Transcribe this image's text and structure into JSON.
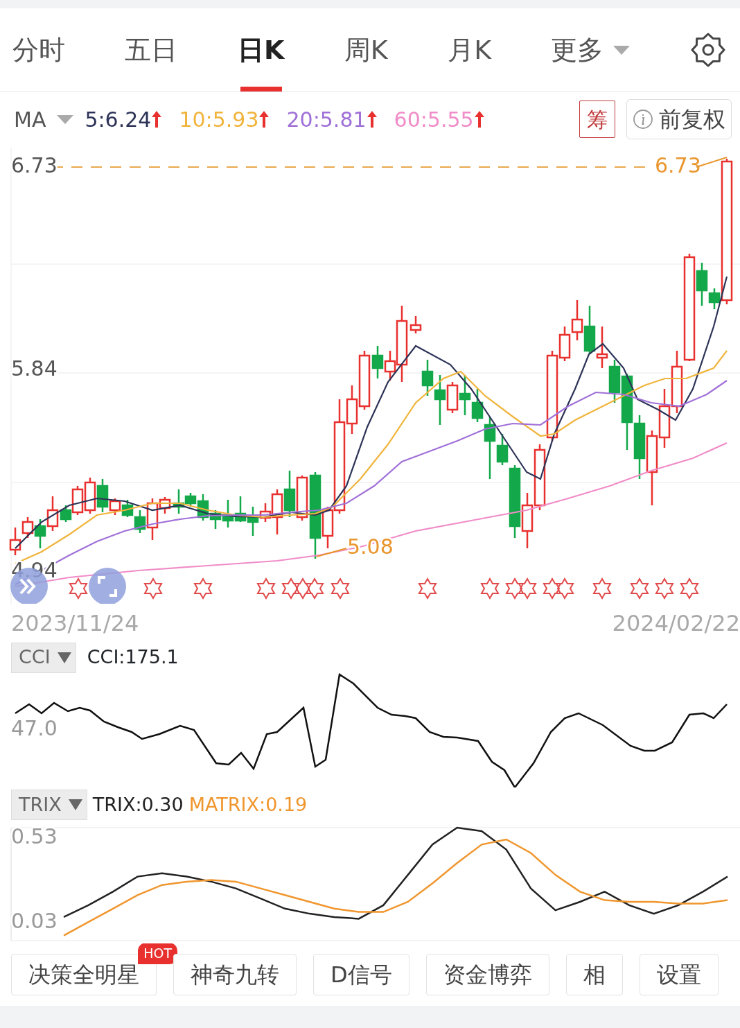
{
  "tabs": [
    {
      "label": "分时",
      "selected": false,
      "kind": "plain"
    },
    {
      "label": "五日",
      "selected": false,
      "kind": "plain"
    },
    {
      "label": "日K",
      "selected": true,
      "kind": "plain"
    },
    {
      "label": "周K",
      "selected": false,
      "kind": "plain"
    },
    {
      "label": "月K",
      "selected": false,
      "kind": "plain"
    },
    {
      "label": "更多",
      "selected": false,
      "kind": "dropdown"
    }
  ],
  "ma_legend": {
    "label": "MA",
    "items": [
      {
        "text": "5:6.24",
        "color": "#2d3357"
      },
      {
        "text": "10:5.93",
        "color": "#f0b43c"
      },
      {
        "text": "20:5.81",
        "color": "#a070d8"
      },
      {
        "text": "60:5.55",
        "color": "#f08cc8"
      }
    ]
  },
  "chip_button": "筹",
  "adjust_button": "前复权",
  "main_chart": {
    "price_labels": [
      "6.73",
      "5.84",
      "4.94"
    ],
    "high_label": "6.73",
    "low_label": "5.08",
    "start_date": "2023/11/24",
    "end_date": "2024/02/22"
  },
  "cci": {
    "selector": "CCI",
    "value": "CCI:175.1",
    "tick": "47.0"
  },
  "trix": {
    "selector": "TRIX",
    "values": [
      {
        "text": "TRIX:0.30",
        "color": "#222222"
      },
      {
        "text": "MATRIX:0.19",
        "color": "#f0962e"
      }
    ],
    "chart_data": {
      "type": "line",
      "ylim": [
        -0.09,
        0.58
      ],
      "yticks": [
        {
          "value": 0.53,
          "label": "0.53"
        },
        {
          "value": 0.03,
          "label": "0.03"
        }
      ],
      "series": [
        {
          "color": "#222222",
          "values": [
            0.05,
            0.12,
            0.2,
            0.29,
            0.31,
            0.29,
            0.26,
            0.22,
            0.16,
            0.1,
            0.07,
            0.05,
            0.04,
            0.12,
            0.3,
            0.48,
            0.58,
            0.56,
            0.45,
            0.22,
            0.09,
            0.14,
            0.2,
            0.12,
            0.07,
            0.12,
            0.2,
            0.29
          ]
        },
        {
          "color": "#f0962e",
          "values": [
            -0.06,
            0.02,
            0.1,
            0.18,
            0.24,
            0.26,
            0.27,
            0.26,
            0.22,
            0.18,
            0.14,
            0.1,
            0.08,
            0.08,
            0.14,
            0.25,
            0.37,
            0.48,
            0.51,
            0.43,
            0.3,
            0.2,
            0.15,
            0.14,
            0.14,
            0.13,
            0.13,
            0.15
          ]
        }
      ]
    }
  },
  "feature_buttons": [
    {
      "label": "决策全明星",
      "badge": "HOT"
    },
    {
      "label": "神奇九转"
    },
    {
      "label": "D信号"
    },
    {
      "label": "资金博弈"
    },
    {
      "label": "相"
    },
    {
      "label": "设置"
    }
  ]
}
